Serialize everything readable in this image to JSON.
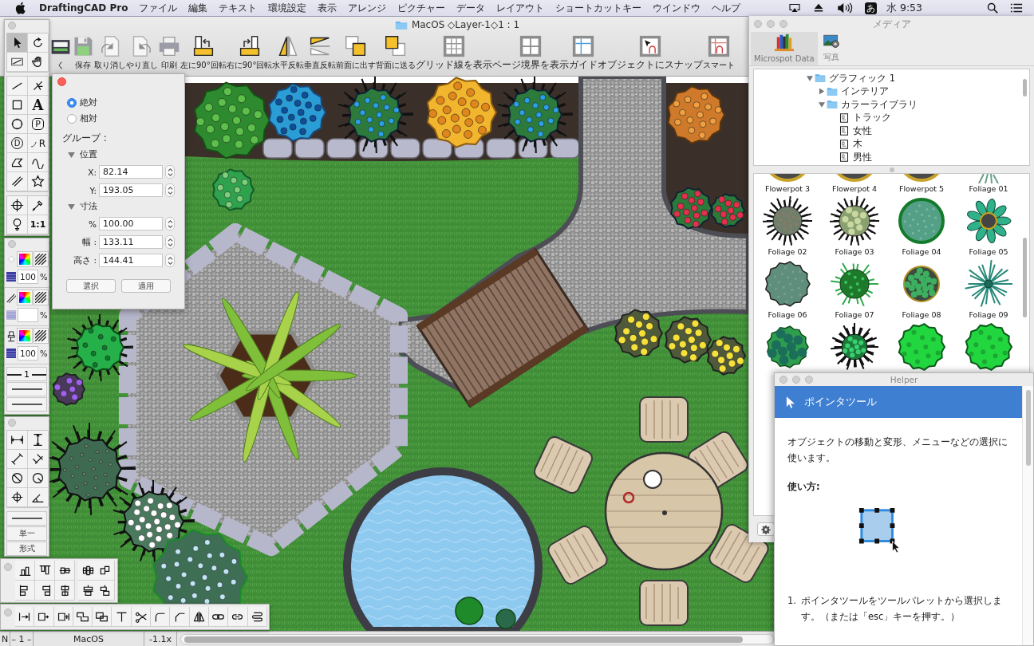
{
  "menubar": {
    "app_name": "DraftingCAD Pro",
    "menus": [
      "ファイル",
      "編集",
      "テキスト",
      "環境設定",
      "表示",
      "アレンジ",
      "ピクチャー",
      "データ",
      "レイアウト",
      "ショートカットキー",
      "ウインドウ",
      "ヘルプ"
    ],
    "input_mode": "あ",
    "clock": "水 9:53"
  },
  "window": {
    "title": "MacOS ◇Layer-1◇1 : 1"
  },
  "toolbar": [
    {
      "label": "く",
      "kind": "open"
    },
    {
      "label": "保存",
      "kind": "save"
    },
    {
      "label": "取り消し",
      "kind": "undo"
    },
    {
      "label": "やり直し",
      "kind": "redo"
    },
    {
      "label": "印刷",
      "kind": "print"
    },
    {
      "label": "左に90°回転",
      "kind": "ccw"
    },
    {
      "label": "右に90°回転",
      "kind": "cw"
    },
    {
      "label": "水平反転",
      "kind": "mirror"
    },
    {
      "label": "垂直反転",
      "kind": "flip"
    },
    {
      "label": "前面に出す",
      "kind": "front"
    },
    {
      "label": "背面に送る",
      "kind": "back"
    },
    {
      "label": "グリッド線を表示",
      "kind": "grid"
    },
    {
      "label": "ページ境界を表示",
      "kind": "pages"
    },
    {
      "label": "ガイド",
      "kind": "guides"
    },
    {
      "label": "オブジェクトにスナップ",
      "kind": "snap"
    },
    {
      "label": "スマート",
      "kind": "smart"
    }
  ],
  "tool_palette": {
    "groups": [
      {
        "tools": [
          {
            "kind": "pointer",
            "selected": true
          },
          {
            "kind": "rotate",
            "selected": false
          },
          {
            "kind": "marquee",
            "selected": false
          },
          {
            "kind": "hand",
            "selected": false
          }
        ]
      },
      {
        "tools": [
          {
            "kind": "line",
            "selected": false
          },
          {
            "kind": "angle",
            "selected": false
          },
          {
            "kind": "rectangle",
            "selected": false
          },
          {
            "kind": "text",
            "glyph": "A",
            "selected": false
          },
          {
            "kind": "circle",
            "selected": false
          },
          {
            "kind": "boxed",
            "glyph": "P",
            "selected": false
          },
          {
            "kind": "circled",
            "glyph": "D",
            "selected": false
          },
          {
            "kind": "arc",
            "glyph": "R",
            "selected": false
          },
          {
            "kind": "polygon",
            "selected": false
          },
          {
            "kind": "curve",
            "selected": false
          },
          {
            "kind": "parallel",
            "selected": false
          },
          {
            "kind": "star",
            "selected": false
          }
        ]
      },
      {
        "tools": [
          {
            "kind": "crosshair",
            "selected": false
          },
          {
            "kind": "eyedropper",
            "selected": false
          },
          {
            "kind": "pin",
            "selected": false
          },
          {
            "kind": "scale",
            "glyph": "1:1",
            "selected": false
          }
        ]
      }
    ]
  },
  "attribute_palette": {
    "rows": [
      {
        "kind": "fill",
        "opacity": "100",
        "unit": "%"
      },
      {
        "kind": "pen",
        "unit": "%"
      },
      {
        "kind": "shadow",
        "opacity": "100",
        "unit": "%"
      }
    ],
    "line_styles": [
      {
        "kind": "weight",
        "label": "1"
      },
      {
        "kind": "solid"
      },
      {
        "kind": "solid"
      }
    ]
  },
  "dimension_palette": {
    "tools": [
      {
        "kind": "horizontal",
        "selected": false
      },
      {
        "kind": "vertical",
        "selected": false
      },
      {
        "kind": "slanted",
        "selected": false
      },
      {
        "kind": "perpendicular",
        "selected": false
      },
      {
        "kind": "diameter",
        "selected": false
      },
      {
        "kind": "radius",
        "selected": false
      },
      {
        "kind": "center",
        "selected": false
      },
      {
        "kind": "angular",
        "selected": false
      }
    ],
    "line_style": {
      "kind": "solid"
    },
    "mode": "単一",
    "format_button": "形式"
  },
  "align_palette": {
    "buttons": [
      {
        "kind": "bottoms"
      },
      {
        "kind": "tops"
      },
      {
        "kind": "middles"
      },
      {
        "kind": "spreadh"
      },
      {
        "kind": "stackh"
      },
      {
        "kind": "lefts"
      },
      {
        "kind": "rights"
      },
      {
        "kind": "centers"
      },
      {
        "kind": "spreadv"
      },
      {
        "kind": "stackv"
      }
    ]
  },
  "edit_toolbar": {
    "buttons": [
      {
        "kind": "trim"
      },
      {
        "kind": "extend"
      },
      {
        "kind": "join"
      },
      {
        "kind": "combine"
      },
      {
        "kind": "subtract"
      },
      {
        "kind": "tee"
      },
      {
        "kind": "cut"
      },
      {
        "kind": "fillet"
      },
      {
        "kind": "chamfer"
      },
      {
        "kind": "mirror"
      },
      {
        "kind": "chain"
      },
      {
        "kind": "link"
      },
      {
        "kind": "coil"
      }
    ]
  },
  "inspector": {
    "modes": [
      {
        "label": "絶対",
        "selected": true
      },
      {
        "label": "相対",
        "selected": false
      }
    ],
    "group_label": "グループ :",
    "sections": [
      {
        "label": "位置",
        "expanded": true,
        "fields": [
          {
            "label": "X:",
            "value": "82.14"
          },
          {
            "label": "Y:",
            "value": "193.05"
          }
        ]
      },
      {
        "label": "寸法",
        "expanded": true,
        "fields": [
          {
            "label": "%",
            "value": "100.00"
          },
          {
            "label": "幅 :",
            "value": "133.11"
          },
          {
            "label": "高さ :",
            "value": "144.41"
          }
        ]
      }
    ],
    "buttons": [
      "選択",
      "適用"
    ]
  },
  "media": {
    "title": "メディア",
    "tabs": [
      {
        "label": "Microspot Data",
        "kind": "library",
        "selected": true
      },
      {
        "label": "写真",
        "kind": "photos",
        "selected": false
      }
    ],
    "tree": [
      {
        "label": "グラフィック 1",
        "kind": "folder",
        "expanded": true,
        "children": [
          {
            "label": "インテリア",
            "kind": "folder",
            "expanded": false
          },
          {
            "label": "カラーライブラリ",
            "kind": "folder",
            "expanded": true,
            "children": [
              {
                "label": "トラック",
                "kind": "document"
              },
              {
                "label": "女性",
                "kind": "document"
              },
              {
                "label": "木",
                "kind": "document"
              },
              {
                "label": "男性",
                "kind": "document"
              }
            ]
          }
        ]
      }
    ],
    "items": [
      {
        "label": "Flowerpot 3",
        "kind": "pot"
      },
      {
        "label": "Flowerpot 4",
        "kind": "pot"
      },
      {
        "label": "Flowerpot 5",
        "kind": "pot"
      },
      {
        "label": "Foliage 01",
        "kind": "tips"
      },
      {
        "label": "Foliage 02",
        "kind": "spiky"
      },
      {
        "label": "Foliage 03",
        "kind": "camo"
      },
      {
        "label": "Foliage 04",
        "kind": "disc"
      },
      {
        "label": "Foliage 05",
        "kind": "leaves"
      },
      {
        "label": "Foliage 06",
        "kind": "blob"
      },
      {
        "label": "Foliage 07",
        "kind": "star"
      },
      {
        "label": "Foliage 08",
        "kind": "berries"
      },
      {
        "label": "Foliage 09",
        "kind": "fronds"
      },
      {
        "kind": "cluster"
      },
      {
        "kind": "burst"
      },
      {
        "kind": "bright"
      },
      {
        "kind": "bright"
      }
    ]
  },
  "helper": {
    "title": "Helper",
    "heading": "ポインタツール",
    "description": "オブジェクトの移動と変形、メニューなどの選択に使います。",
    "usage_label": "使い方:",
    "steps": [
      {
        "number": "1.",
        "text": "ポインタツールをツールパレットから選択します。（または「esc」キーを押す。）"
      }
    ]
  },
  "status_bar": {
    "orientation": "N",
    "page": "– 1 –",
    "layer": "MacOS",
    "zoom": "-1.1x"
  }
}
